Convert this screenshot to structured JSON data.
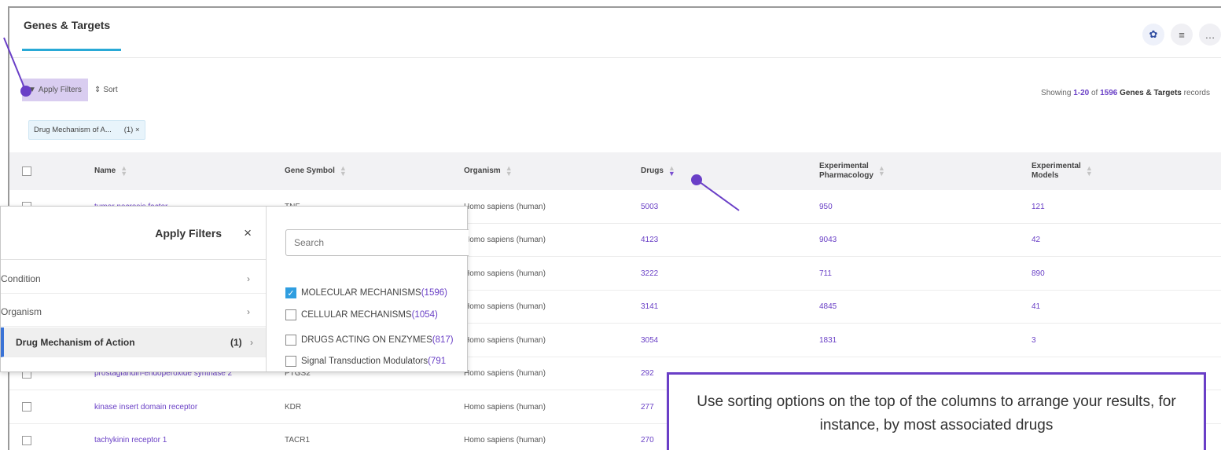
{
  "tab": {
    "label": "Genes & Targets"
  },
  "toolbar": {
    "filter_label": "Apply Filters",
    "sort_label": "Sort"
  },
  "showing": {
    "prefix": "Showing ",
    "range": "1-20",
    "mid": " of ",
    "total": "1596",
    "entity": "Genes & Targets",
    "suffix": " records"
  },
  "chip": {
    "label": "Drug Mechanism of A...",
    "count": "(1)",
    "close": "×"
  },
  "columns": {
    "name": "Name",
    "symbol": "Gene Symbol",
    "organism": "Organism",
    "drugs": "Drugs",
    "exp_pharm_1": "Experimental",
    "exp_pharm_2": "Pharmacology",
    "exp_models_1": "Experimental",
    "exp_models_2": "Models"
  },
  "rows": [
    {
      "name": "tumor necrosis factor",
      "symbol": "TNF",
      "organism": "Homo sapiens (human)",
      "drugs": "5003",
      "exp": "950",
      "models": "121"
    },
    {
      "name": "",
      "symbol": "",
      "organism": "Homo sapiens (human)",
      "drugs": "4123",
      "exp": "9043",
      "models": "42"
    },
    {
      "name": "",
      "symbol": "",
      "organism": "Homo sapiens (human)",
      "drugs": "3222",
      "exp": "711",
      "models": "890"
    },
    {
      "name": "",
      "symbol": "",
      "organism": "Homo sapiens (human)",
      "drugs": "3141",
      "exp": "4845",
      "models": "41"
    },
    {
      "name": "",
      "symbol": "",
      "organism": "Homo sapiens (human)",
      "drugs": "3054",
      "exp": "1831",
      "models": "3"
    },
    {
      "name": "prostaglandin-endoperoxide synthase 2",
      "symbol": "PTGS2",
      "organism": "Homo sapiens (human)",
      "drugs": "292",
      "exp": "",
      "models": ""
    },
    {
      "name": "kinase insert domain receptor",
      "symbol": "KDR",
      "organism": "Homo sapiens (human)",
      "drugs": "277",
      "exp": "",
      "models": ""
    },
    {
      "name": "tachykinin receptor 1",
      "symbol": "TACR1",
      "organism": "Homo sapiens (human)",
      "drugs": "270",
      "exp": "",
      "models": ""
    }
  ],
  "filter_panel": {
    "title": "Apply Filters",
    "close": "×",
    "categories": [
      {
        "label": "Condition",
        "count": ""
      },
      {
        "label": "Organism",
        "count": ""
      },
      {
        "label": "Drug Mechanism of Action",
        "count": "(1)"
      }
    ],
    "search_placeholder": "Search",
    "options": [
      {
        "label": "MOLECULAR MECHANISMS",
        "count": "(1596)",
        "checked": true
      },
      {
        "label": "CELLULAR MECHANISMS",
        "count": "(1054)",
        "checked": false
      },
      {
        "label": "DRUGS ACTING ON ENZYMES",
        "count": "(817)",
        "checked": false
      },
      {
        "label": "Signal Transduction Modulators",
        "count": "(791",
        "checked": false
      }
    ]
  },
  "callout": {
    "text": "Use sorting options on the top of the columns to arrange your results, for instance, by most associated drugs"
  },
  "accent_color": "#6a3fc7"
}
